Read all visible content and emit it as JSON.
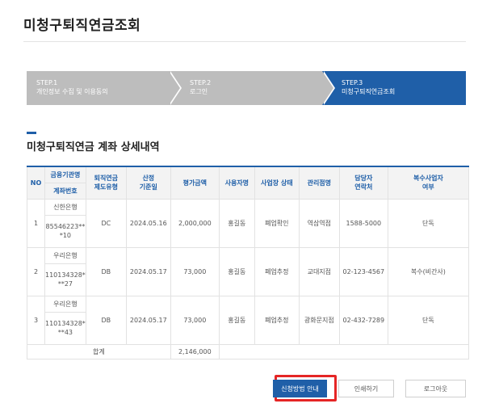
{
  "page_title": "미청구퇴직연금조회",
  "steps": [
    {
      "step": "STEP.1",
      "label": "개인정보 수집 및 이용동의"
    },
    {
      "step": "STEP.2",
      "label": "로그인"
    },
    {
      "step": "STEP.3",
      "label": "미청구퇴직연금조회"
    }
  ],
  "active_step": 3,
  "section_title": "미청구퇴직연금 계좌 상세내역",
  "table": {
    "headers": {
      "no": "NO",
      "institution": "금융기관명",
      "account": "계좌번호",
      "plan_type": "퇴직연금\n제도유형",
      "base_date": "산정\n기준일",
      "amount": "평가금액",
      "employer": "사용자명",
      "status": "사업장 상태",
      "manager": "관리점명",
      "contact": "담당자\n연락처",
      "multi": "복수사업자\n여부"
    },
    "rows": [
      {
        "no": "1",
        "institution": "신한은행",
        "account": "85546223**\n*10",
        "plan_type": "DC",
        "base_date": "2024.05.16",
        "amount": "2,000,000",
        "employer": "홍길동",
        "status": "폐업확인",
        "manager": "역삼역점",
        "contact": "1588-5000",
        "multi": "단독"
      },
      {
        "no": "2",
        "institution": "우리은행",
        "account": "110134328*\n**27",
        "plan_type": "DB",
        "base_date": "2024.05.17",
        "amount": "73,000",
        "employer": "홍길동",
        "status": "폐업추정",
        "manager": "교대지점",
        "contact": "02-123-4567",
        "multi": "복수(비간사)"
      },
      {
        "no": "3",
        "institution": "우리은행",
        "account": "110134328*\n**43",
        "plan_type": "DB",
        "base_date": "2024.05.17",
        "amount": "73,000",
        "employer": "홍길동",
        "status": "폐업추정",
        "manager": "광화문지점",
        "contact": "02-432-7289",
        "multi": "단독"
      }
    ],
    "total_label": "합계",
    "total_amount": "2,146,000"
  },
  "buttons": {
    "guide": "신청방법 안내",
    "print": "인쇄하기",
    "logout": "로그아웃"
  },
  "colors": {
    "accent": "#1f5fa8",
    "highlight": "#e52525",
    "step_inactive": "#bdbdbd"
  }
}
